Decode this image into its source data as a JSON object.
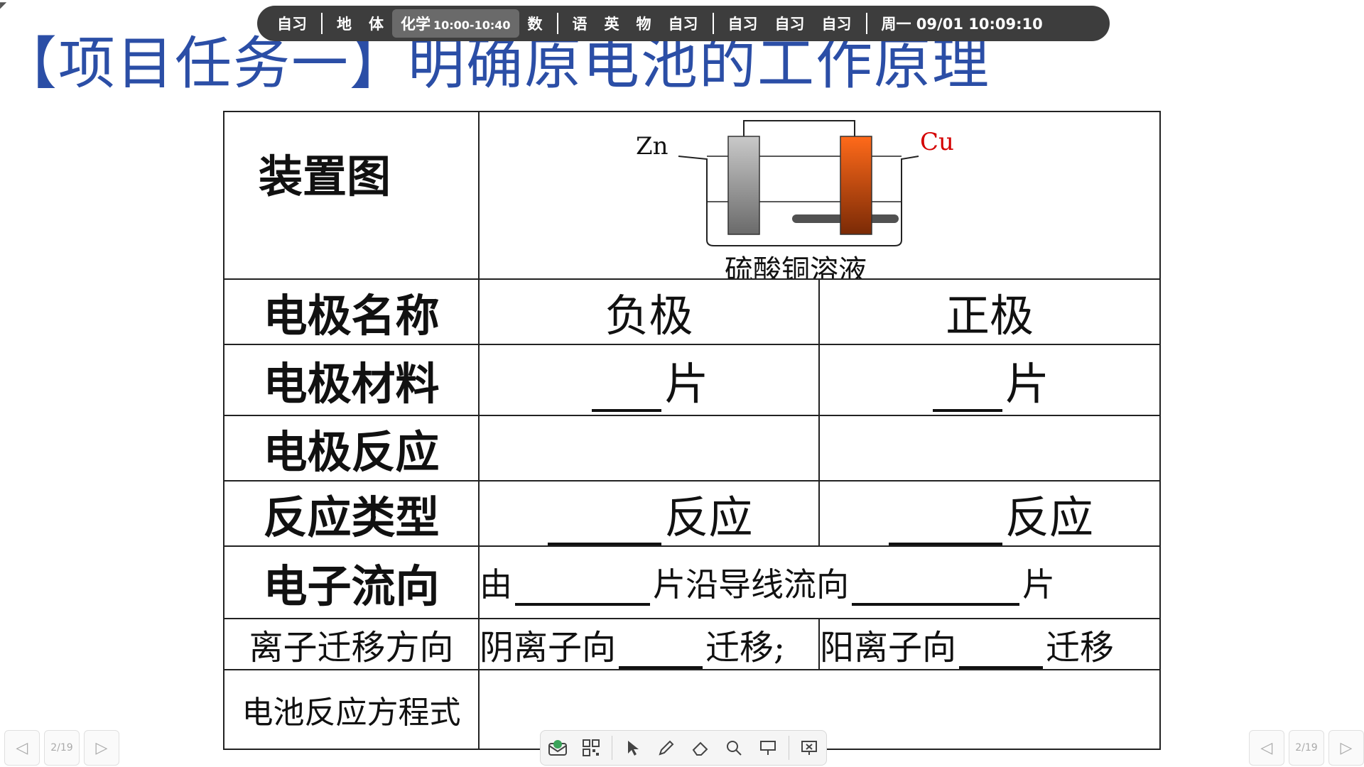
{
  "schedule": {
    "group1": [
      "自习"
    ],
    "group2": [
      "地",
      "体"
    ],
    "current": {
      "subject": "化学",
      "time": "10:00-10:40"
    },
    "group2b": [
      "数"
    ],
    "group3": [
      "语",
      "英",
      "物",
      "自习"
    ],
    "group4": [
      "自习",
      "自习",
      "自习"
    ],
    "clock": "周一 09/01  10:09:10"
  },
  "slide": {
    "title": "【项目任务一】明确原电池的工作原理"
  },
  "table": {
    "device_label": "装置图",
    "device": {
      "zn": "Zn",
      "cu": "Cu",
      "caption": "硫酸铜溶液"
    },
    "rows": {
      "electrode_name": {
        "label": "电极名称",
        "left": "负极",
        "right": "正极"
      },
      "electrode_material": {
        "label": "电极材料",
        "left_suffix": "片",
        "right_suffix": "片"
      },
      "electrode_reaction": {
        "label": "电极反应"
      },
      "reaction_type": {
        "label": "反应类型",
        "left_suffix": "反应",
        "right_suffix": "反应"
      },
      "electron_flow": {
        "label": "电子流向",
        "prefix": "由",
        "middle": "片沿导线流向",
        "suffix": "片"
      },
      "ion_migration": {
        "label": "离子迁移方向",
        "left_prefix": "阴离子向",
        "left_suffix": "迁移;",
        "right_prefix": "阳离子向",
        "right_suffix": "迁移"
      },
      "equation": {
        "label": "电池反应方程式"
      }
    }
  },
  "pager": {
    "count": "2/19"
  },
  "colors": {
    "title": "#2b4ea6",
    "cu_label": "#d40000",
    "copper": "#e2571a",
    "zinc": "#a8a8a8"
  },
  "toolbar_icons": [
    "whiteboard-icon",
    "grid-icon",
    "pointer-icon",
    "pen-icon",
    "eraser-icon",
    "zoom-icon",
    "board-icon",
    "exit-present-icon"
  ]
}
